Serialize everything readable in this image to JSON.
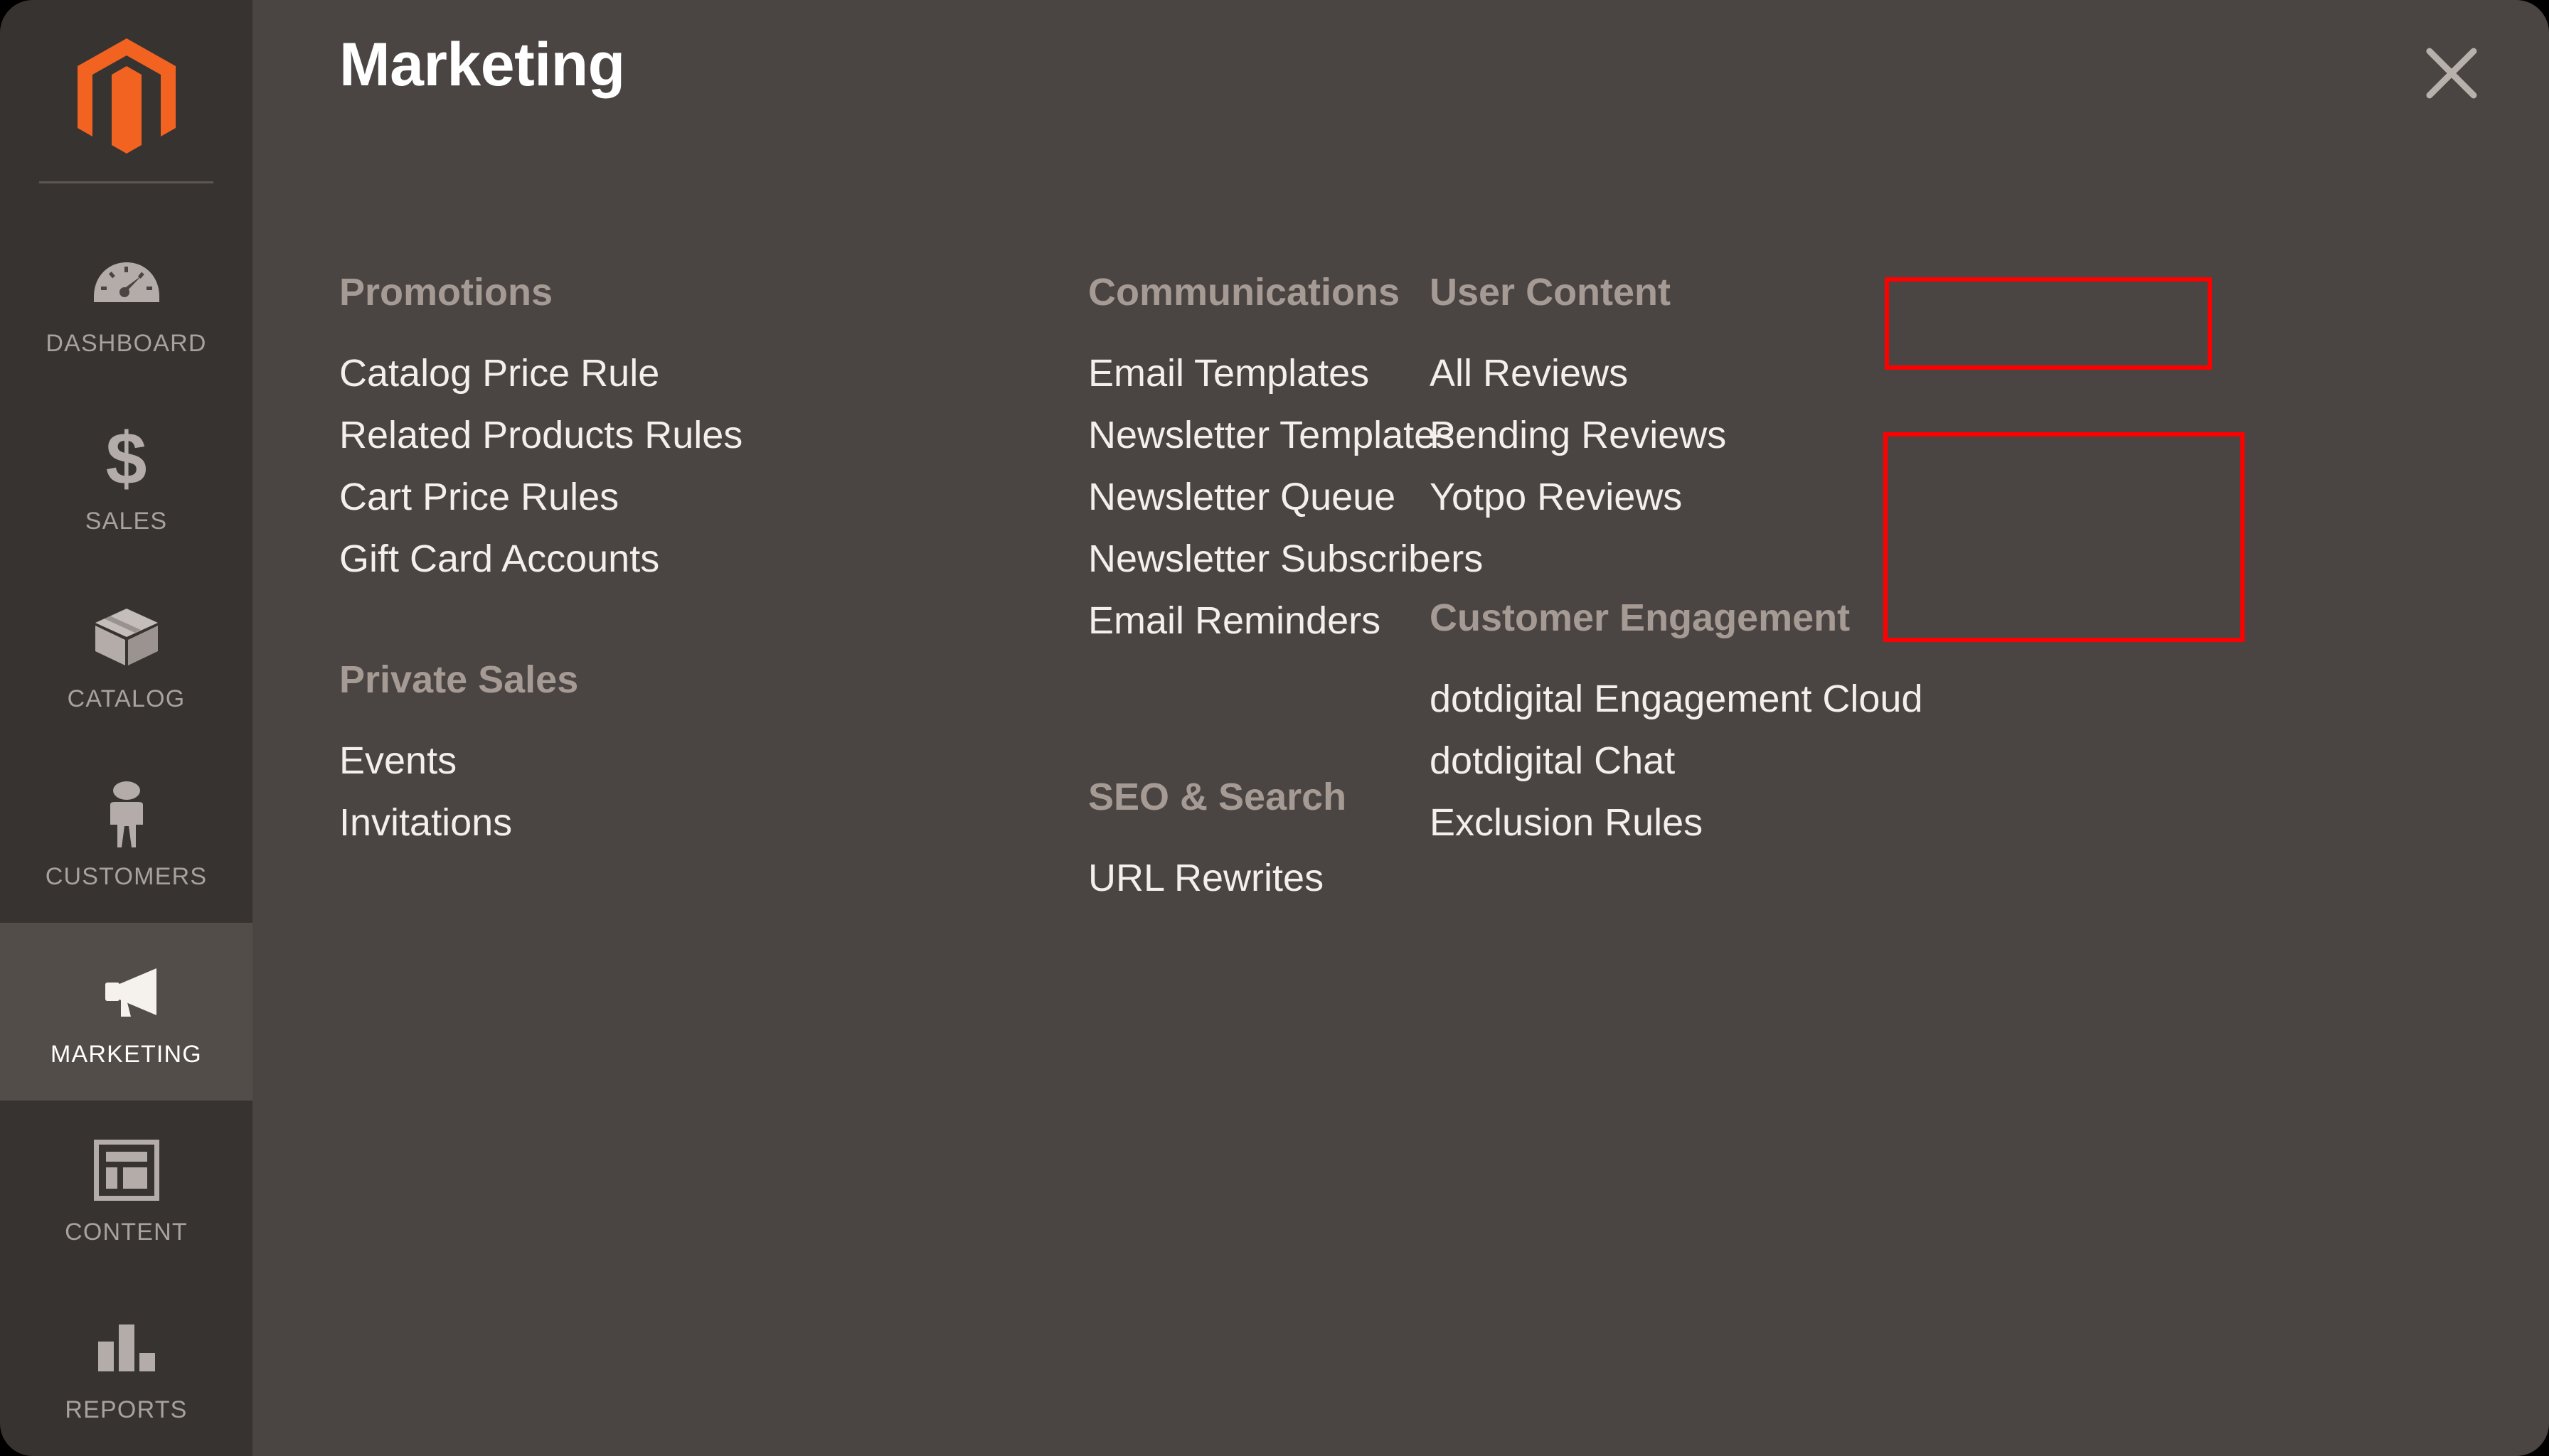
{
  "sidebar": {
    "logo_icon": "magento-logo-icon",
    "items": [
      {
        "label": "DASHBOARD",
        "icon": "gauge-icon",
        "active": false
      },
      {
        "label": "SALES",
        "icon": "dollar-icon",
        "active": false
      },
      {
        "label": "CATALOG",
        "icon": "box-icon",
        "active": false
      },
      {
        "label": "CUSTOMERS",
        "icon": "person-icon",
        "active": false
      },
      {
        "label": "MARKETING",
        "icon": "megaphone-icon",
        "active": true
      },
      {
        "label": "CONTENT",
        "icon": "layout-icon",
        "active": false
      },
      {
        "label": "REPORTS",
        "icon": "bar-chart-icon",
        "active": false
      }
    ]
  },
  "panel": {
    "title": "Marketing",
    "close_icon": "close-icon",
    "columns": [
      {
        "groups": [
          {
            "title": "Promotions",
            "items": [
              "Catalog Price Rule",
              "Related Products Rules",
              "Cart Price Rules",
              "Gift Card Accounts"
            ]
          },
          {
            "title": "Private Sales",
            "items": [
              "Events",
              "Invitations"
            ]
          }
        ]
      },
      {
        "groups": [
          {
            "title": "Communications",
            "items": [
              "Email Templates",
              "Newsletter Templates",
              "Newsletter Queue",
              "Newsletter Subscribers",
              "Email Reminders"
            ]
          },
          {
            "title": "SEO & Search",
            "items": [
              "URL Rewrites"
            ]
          }
        ]
      },
      {
        "groups": [
          {
            "title": "User Content",
            "items": [
              "All Reviews",
              "Pending Reviews",
              "Yotpo Reviews"
            ]
          },
          {
            "title": "Customer Engagement",
            "items": [
              "dotdigital Engagement Cloud",
              "dotdigital Chat",
              "Exclusion Rules"
            ]
          }
        ]
      }
    ]
  },
  "annotations": [
    {
      "name": "user-content-heading-highlight",
      "color": "#ff0000"
    },
    {
      "name": "reviews-links-highlight",
      "color": "#ff0000"
    }
  ],
  "colors": {
    "sidebar_bg": "#373330",
    "panel_bg": "#4a4542",
    "active_bg": "#534d49",
    "brand_orange": "#f26322",
    "group_title": "#a69b94",
    "link": "#f3efec",
    "annotation": "#ff0000"
  }
}
